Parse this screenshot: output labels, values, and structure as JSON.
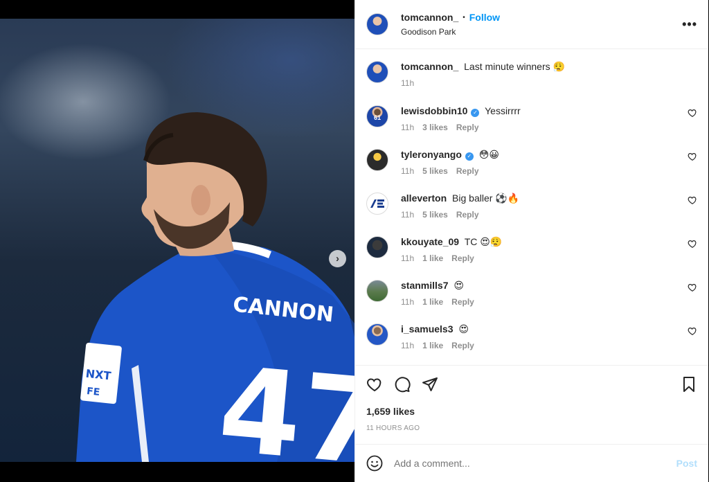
{
  "post": {
    "author": "tomcannon_",
    "follow_label": "Follow",
    "separator": "•",
    "location": "Goodison Park",
    "more_icon": "more-options-icon",
    "image": {
      "jersey_name": "CANNON",
      "jersey_number": "47",
      "sleeve_badge_line1": "NXT",
      "sleeve_badge_line2": "FE",
      "carousel_next": "›",
      "carousel_pages": 2,
      "carousel_current": 1
    },
    "caption": {
      "username": "tomcannon_",
      "text": "Last minute winners 😮‍💨",
      "time": "11h"
    },
    "comments": [
      {
        "username": "lewisdobbin10",
        "verified": true,
        "text": "Yessirrrr",
        "time": "11h",
        "likes": "3 likes",
        "reply": "Reply",
        "avatar_num": "61"
      },
      {
        "username": "tyleronyango",
        "verified": true,
        "text": "😳😀",
        "time": "11h",
        "likes": "5 likes",
        "reply": "Reply"
      },
      {
        "username": "alleverton",
        "verified": false,
        "text": "Big baller ⚽🔥",
        "time": "11h",
        "likes": "5 likes",
        "reply": "Reply"
      },
      {
        "username": "kkouyate_09",
        "verified": false,
        "text": "TC 😍😮‍💨",
        "time": "11h",
        "likes": "1 like",
        "reply": "Reply"
      },
      {
        "username": "stanmills7",
        "verified": false,
        "text": "😍",
        "time": "11h",
        "likes": "1 like",
        "reply": "Reply"
      },
      {
        "username": "i_samuels3",
        "verified": false,
        "text": "😍",
        "time": "11h",
        "likes": "1 like",
        "reply": "Reply"
      }
    ],
    "likes_count": "1,659 likes",
    "posted_ago": "11 HOURS AGO",
    "add_comment_placeholder": "Add a comment...",
    "post_label": "Post"
  },
  "colors": {
    "accent": "#0095f6",
    "post_disabled": "#b2dffc",
    "jersey_blue": "#1c55c8",
    "muted": "#8e8e8e"
  }
}
